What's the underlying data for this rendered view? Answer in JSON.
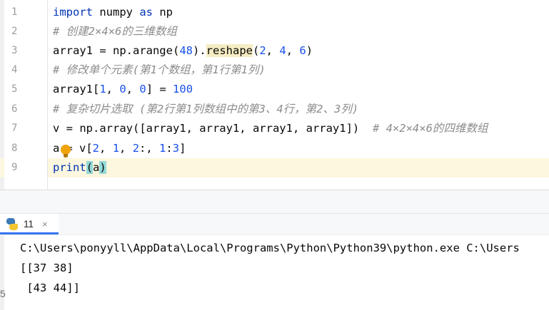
{
  "editor": {
    "line_numbers": [
      "1",
      "2",
      "3",
      "4",
      "5",
      "6",
      "7",
      "8",
      "9"
    ],
    "code": {
      "l1": {
        "kw1": "import",
        "t1": " numpy ",
        "kw2": "as",
        "t2": " np"
      },
      "l2": {
        "comment": "# 创建2×4×6的三维数组"
      },
      "l3": {
        "t1": "array1 = np.arange(",
        "n1": "48",
        "t2": ").",
        "fn": "reshape",
        "t3": "(",
        "n2": "2",
        "t4": ", ",
        "n3": "4",
        "t5": ", ",
        "n4": "6",
        "t6": ")"
      },
      "l4": {
        "comment": "# 修改单个元素(第1个数组，第1行第1列)"
      },
      "l5": {
        "t1": "array1[",
        "n1": "1",
        "t2": ", ",
        "n2": "0",
        "t3": ", ",
        "n3": "0",
        "t4": "] = ",
        "n4": "100"
      },
      "l6": {
        "comment": "# 复杂切片选取 (第2行第1列数组中的第3、4行，第2、3列)"
      },
      "l7": {
        "t1": "v = np.array([array1, array1, array1, array1])  ",
        "comment": "# 4×2×4×6的四维数组"
      },
      "l8": {
        "t1": "a",
        "t2": "= v[",
        "n1": "2",
        "t3": ", ",
        "n2": "1",
        "t4": ", ",
        "n3": "2",
        "t5": ":, ",
        "n4": "1",
        "t6": ":",
        "n5": "3",
        "t7": "]"
      },
      "l9": {
        "t1": "print",
        "p1": "(",
        "t2": "a",
        "p2": ")"
      }
    }
  },
  "run_panel": {
    "tab_label": "11",
    "close_glyph": "×",
    "output": [
      "C:\\Users\\ponyyll\\AppData\\Local\\Programs\\Python\\Python39\\python.exe C:\\Users",
      "[[37 38]",
      " [43 44]]"
    ],
    "gutter_fragment": "5"
  },
  "colors": {
    "keyword": "#0033b3",
    "number": "#1750eb",
    "comment": "#8c8c8c",
    "current_line": "#fcf7de",
    "paren_match": "#93d9d9",
    "tab_underline": "#3574f0"
  },
  "icons": [
    "bulb-icon",
    "python-icon",
    "close-icon"
  ]
}
